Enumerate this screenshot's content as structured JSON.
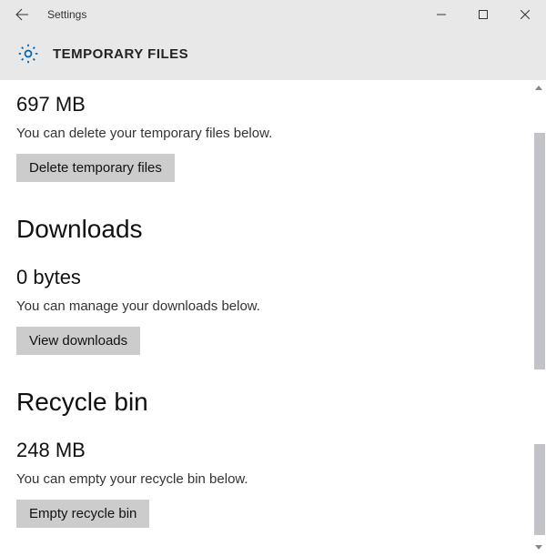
{
  "window": {
    "title": "Settings"
  },
  "header": {
    "title": "TEMPORARY FILES"
  },
  "temp": {
    "size": "697 MB",
    "desc": "You can delete your temporary files below.",
    "button": "Delete temporary files"
  },
  "downloads": {
    "heading": "Downloads",
    "size": "0 bytes",
    "desc": "You can manage your downloads below.",
    "button": "View downloads"
  },
  "recycle": {
    "heading": "Recycle bin",
    "size": "248 MB",
    "desc": "You can empty your recycle bin below.",
    "button": "Empty recycle bin"
  }
}
